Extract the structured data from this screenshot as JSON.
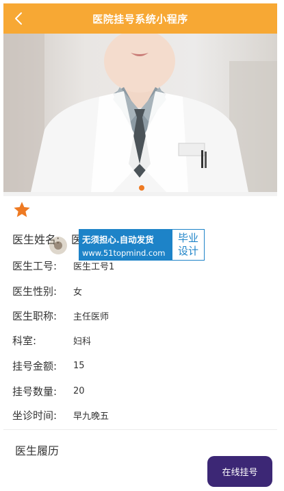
{
  "header": {
    "title": "医院挂号系统小程序"
  },
  "icons": {
    "back": "chevron-left-icon",
    "favorite": "star-icon"
  },
  "colors": {
    "header_bg": "#f7a834",
    "accent": "#ee7a22",
    "button_bg": "#3c2775",
    "watermark_bg": "#1d83c8"
  },
  "doctor": {
    "name_label": "医生姓名:",
    "name_value": "医",
    "rows": [
      {
        "label": "医生工号:",
        "value": "医生工号1"
      },
      {
        "label": "医生性别:",
        "value": "女"
      },
      {
        "label": "医生职称:",
        "value": "主任医师"
      },
      {
        "label": "科室:",
        "value": "妇科"
      },
      {
        "label": "挂号金额:",
        "value": "15"
      },
      {
        "label": "挂号数量:",
        "value": "20"
      },
      {
        "label": "坐诊时间:",
        "value": "早九晚五"
      }
    ]
  },
  "watermark": {
    "line1": "无须担心.自动发货",
    "line2": "www.51topmind.com",
    "right_top": "毕业",
    "right_bottom": "设计"
  },
  "resume": {
    "title": "医生履历"
  },
  "actions": {
    "book_label": "在线挂号"
  }
}
